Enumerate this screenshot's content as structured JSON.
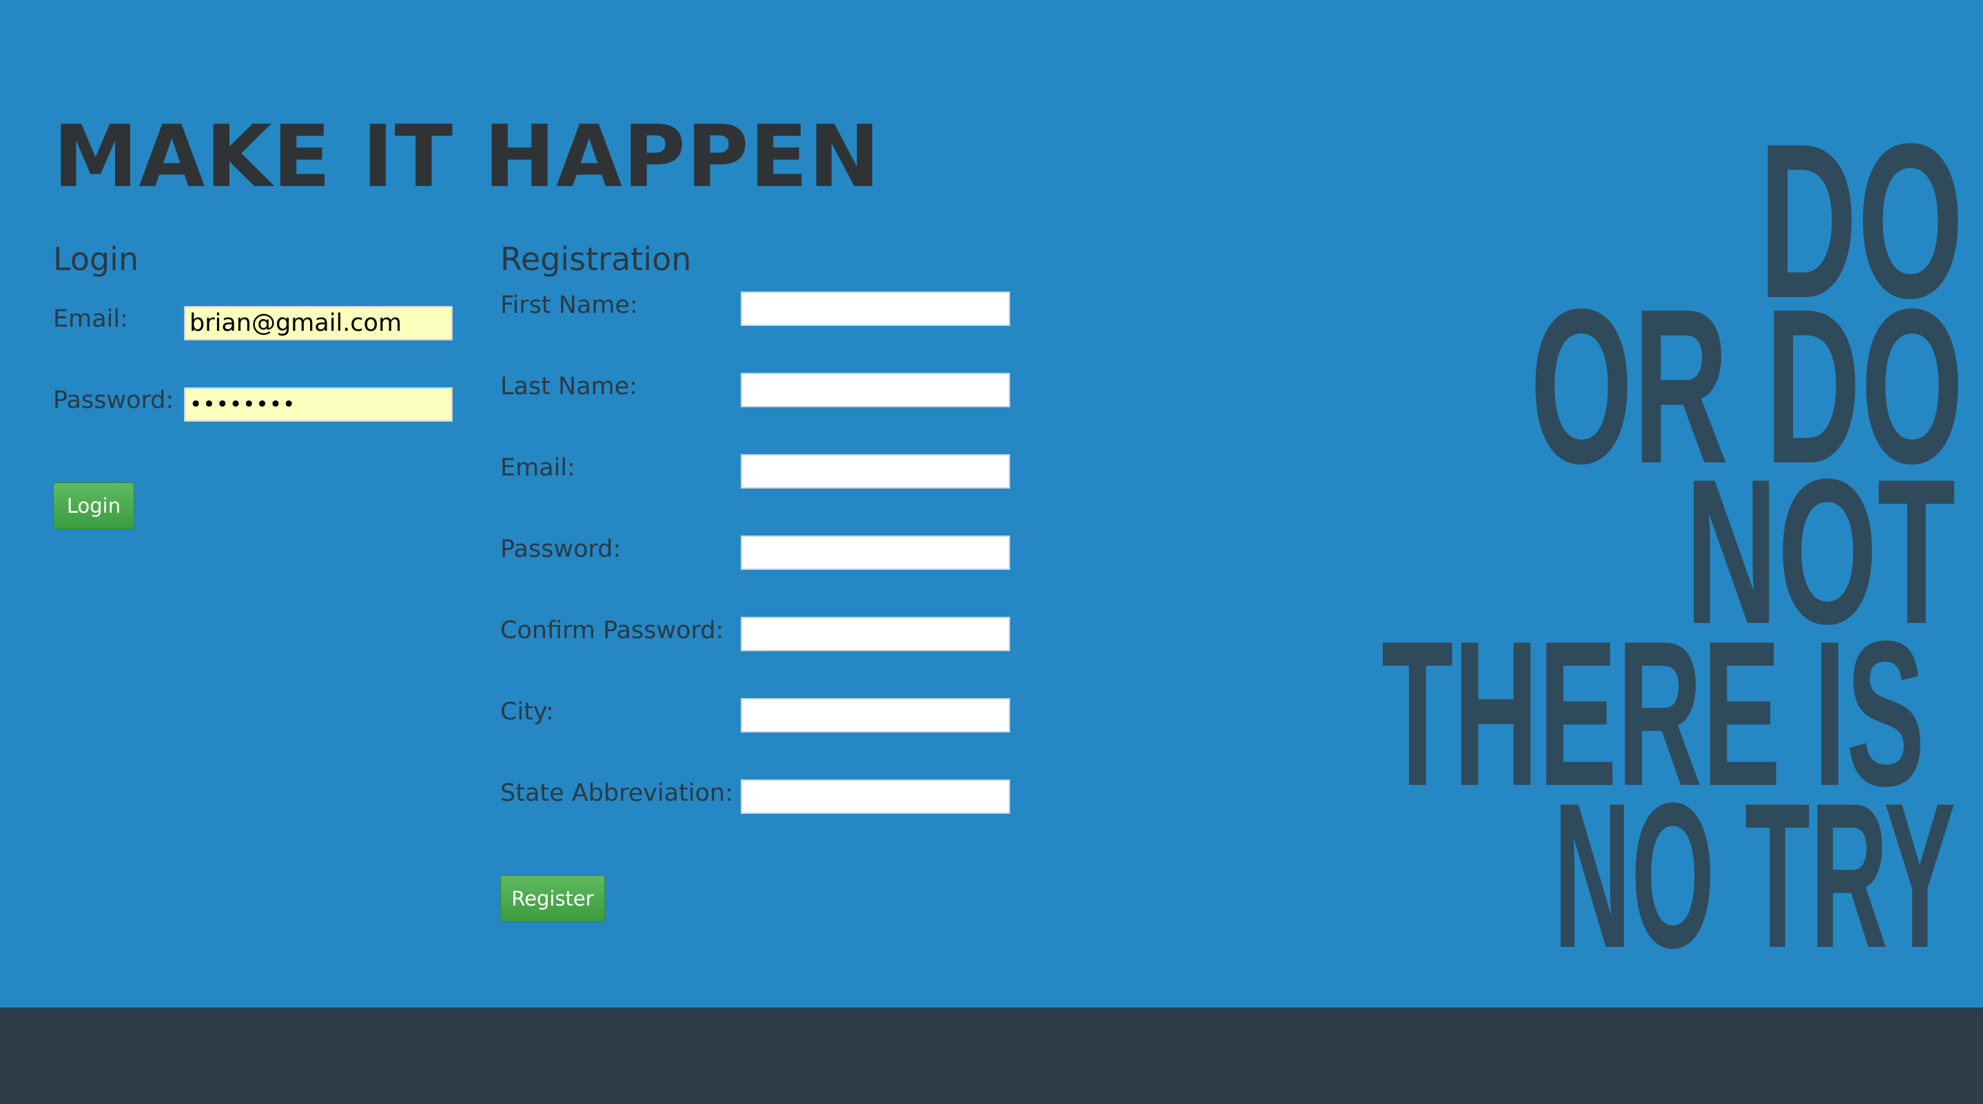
{
  "page": {
    "title": "MAKE IT HAPPEN"
  },
  "login": {
    "heading": "Login",
    "email_label": "Email:",
    "email_value": "brian@gmail.com",
    "password_label": "Password:",
    "password_value": "••••••••",
    "button_label": "Login"
  },
  "registration": {
    "heading": "Registration",
    "fields": [
      {
        "label": "First Name:",
        "value": ""
      },
      {
        "label": "Last Name:",
        "value": ""
      },
      {
        "label": "Email:",
        "value": ""
      },
      {
        "label": "Password:",
        "value": ""
      },
      {
        "label": "Confirm Password:",
        "value": ""
      },
      {
        "label": "City:",
        "value": ""
      },
      {
        "label": "State Abbreviation:",
        "value": ""
      }
    ],
    "button_label": "Register"
  },
  "quote": {
    "lines": [
      "DO",
      "OR DO",
      "NOT",
      "THERE IS",
      "NO TRY"
    ]
  },
  "colors": {
    "background": "#2588c4",
    "footer": "#2d3d49",
    "quote_text": "#2f4a5b",
    "button_green": "#4cae4c",
    "autofill_yellow": "#faffbd"
  }
}
